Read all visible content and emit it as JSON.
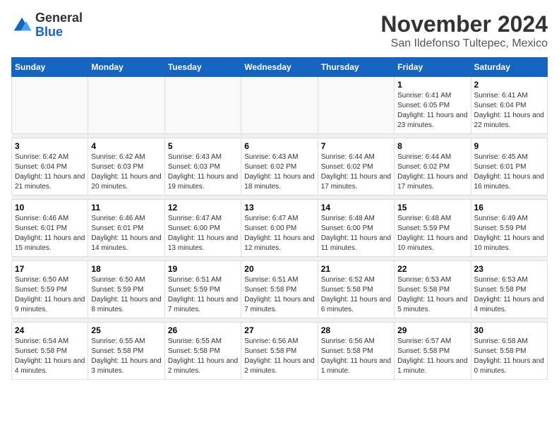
{
  "logo": {
    "general": "General",
    "blue": "Blue"
  },
  "title": "November 2024",
  "location": "San Ildefonso Tultepec, Mexico",
  "days_of_week": [
    "Sunday",
    "Monday",
    "Tuesday",
    "Wednesday",
    "Thursday",
    "Friday",
    "Saturday"
  ],
  "weeks": [
    [
      {
        "day": "",
        "detail": ""
      },
      {
        "day": "",
        "detail": ""
      },
      {
        "day": "",
        "detail": ""
      },
      {
        "day": "",
        "detail": ""
      },
      {
        "day": "",
        "detail": ""
      },
      {
        "day": "1",
        "detail": "Sunrise: 6:41 AM\nSunset: 6:05 PM\nDaylight: 11 hours and 23 minutes."
      },
      {
        "day": "2",
        "detail": "Sunrise: 6:41 AM\nSunset: 6:04 PM\nDaylight: 11 hours and 22 minutes."
      }
    ],
    [
      {
        "day": "3",
        "detail": "Sunrise: 6:42 AM\nSunset: 6:04 PM\nDaylight: 11 hours and 21 minutes."
      },
      {
        "day": "4",
        "detail": "Sunrise: 6:42 AM\nSunset: 6:03 PM\nDaylight: 11 hours and 20 minutes."
      },
      {
        "day": "5",
        "detail": "Sunrise: 6:43 AM\nSunset: 6:03 PM\nDaylight: 11 hours and 19 minutes."
      },
      {
        "day": "6",
        "detail": "Sunrise: 6:43 AM\nSunset: 6:02 PM\nDaylight: 11 hours and 18 minutes."
      },
      {
        "day": "7",
        "detail": "Sunrise: 6:44 AM\nSunset: 6:02 PM\nDaylight: 11 hours and 17 minutes."
      },
      {
        "day": "8",
        "detail": "Sunrise: 6:44 AM\nSunset: 6:02 PM\nDaylight: 11 hours and 17 minutes."
      },
      {
        "day": "9",
        "detail": "Sunrise: 6:45 AM\nSunset: 6:01 PM\nDaylight: 11 hours and 16 minutes."
      }
    ],
    [
      {
        "day": "10",
        "detail": "Sunrise: 6:46 AM\nSunset: 6:01 PM\nDaylight: 11 hours and 15 minutes."
      },
      {
        "day": "11",
        "detail": "Sunrise: 6:46 AM\nSunset: 6:01 PM\nDaylight: 11 hours and 14 minutes."
      },
      {
        "day": "12",
        "detail": "Sunrise: 6:47 AM\nSunset: 6:00 PM\nDaylight: 11 hours and 13 minutes."
      },
      {
        "day": "13",
        "detail": "Sunrise: 6:47 AM\nSunset: 6:00 PM\nDaylight: 11 hours and 12 minutes."
      },
      {
        "day": "14",
        "detail": "Sunrise: 6:48 AM\nSunset: 6:00 PM\nDaylight: 11 hours and 11 minutes."
      },
      {
        "day": "15",
        "detail": "Sunrise: 6:48 AM\nSunset: 5:59 PM\nDaylight: 11 hours and 10 minutes."
      },
      {
        "day": "16",
        "detail": "Sunrise: 6:49 AM\nSunset: 5:59 PM\nDaylight: 11 hours and 10 minutes."
      }
    ],
    [
      {
        "day": "17",
        "detail": "Sunrise: 6:50 AM\nSunset: 5:59 PM\nDaylight: 11 hours and 9 minutes."
      },
      {
        "day": "18",
        "detail": "Sunrise: 6:50 AM\nSunset: 5:59 PM\nDaylight: 11 hours and 8 minutes."
      },
      {
        "day": "19",
        "detail": "Sunrise: 6:51 AM\nSunset: 5:59 PM\nDaylight: 11 hours and 7 minutes."
      },
      {
        "day": "20",
        "detail": "Sunrise: 6:51 AM\nSunset: 5:58 PM\nDaylight: 11 hours and 7 minutes."
      },
      {
        "day": "21",
        "detail": "Sunrise: 6:52 AM\nSunset: 5:58 PM\nDaylight: 11 hours and 6 minutes."
      },
      {
        "day": "22",
        "detail": "Sunrise: 6:53 AM\nSunset: 5:58 PM\nDaylight: 11 hours and 5 minutes."
      },
      {
        "day": "23",
        "detail": "Sunrise: 6:53 AM\nSunset: 5:58 PM\nDaylight: 11 hours and 4 minutes."
      }
    ],
    [
      {
        "day": "24",
        "detail": "Sunrise: 6:54 AM\nSunset: 5:58 PM\nDaylight: 11 hours and 4 minutes."
      },
      {
        "day": "25",
        "detail": "Sunrise: 6:55 AM\nSunset: 5:58 PM\nDaylight: 11 hours and 3 minutes."
      },
      {
        "day": "26",
        "detail": "Sunrise: 6:55 AM\nSunset: 5:58 PM\nDaylight: 11 hours and 2 minutes."
      },
      {
        "day": "27",
        "detail": "Sunrise: 6:56 AM\nSunset: 5:58 PM\nDaylight: 11 hours and 2 minutes."
      },
      {
        "day": "28",
        "detail": "Sunrise: 6:56 AM\nSunset: 5:58 PM\nDaylight: 11 hours and 1 minute."
      },
      {
        "day": "29",
        "detail": "Sunrise: 6:57 AM\nSunset: 5:58 PM\nDaylight: 11 hours and 1 minute."
      },
      {
        "day": "30",
        "detail": "Sunrise: 6:58 AM\nSunset: 5:58 PM\nDaylight: 11 hours and 0 minutes."
      }
    ]
  ]
}
